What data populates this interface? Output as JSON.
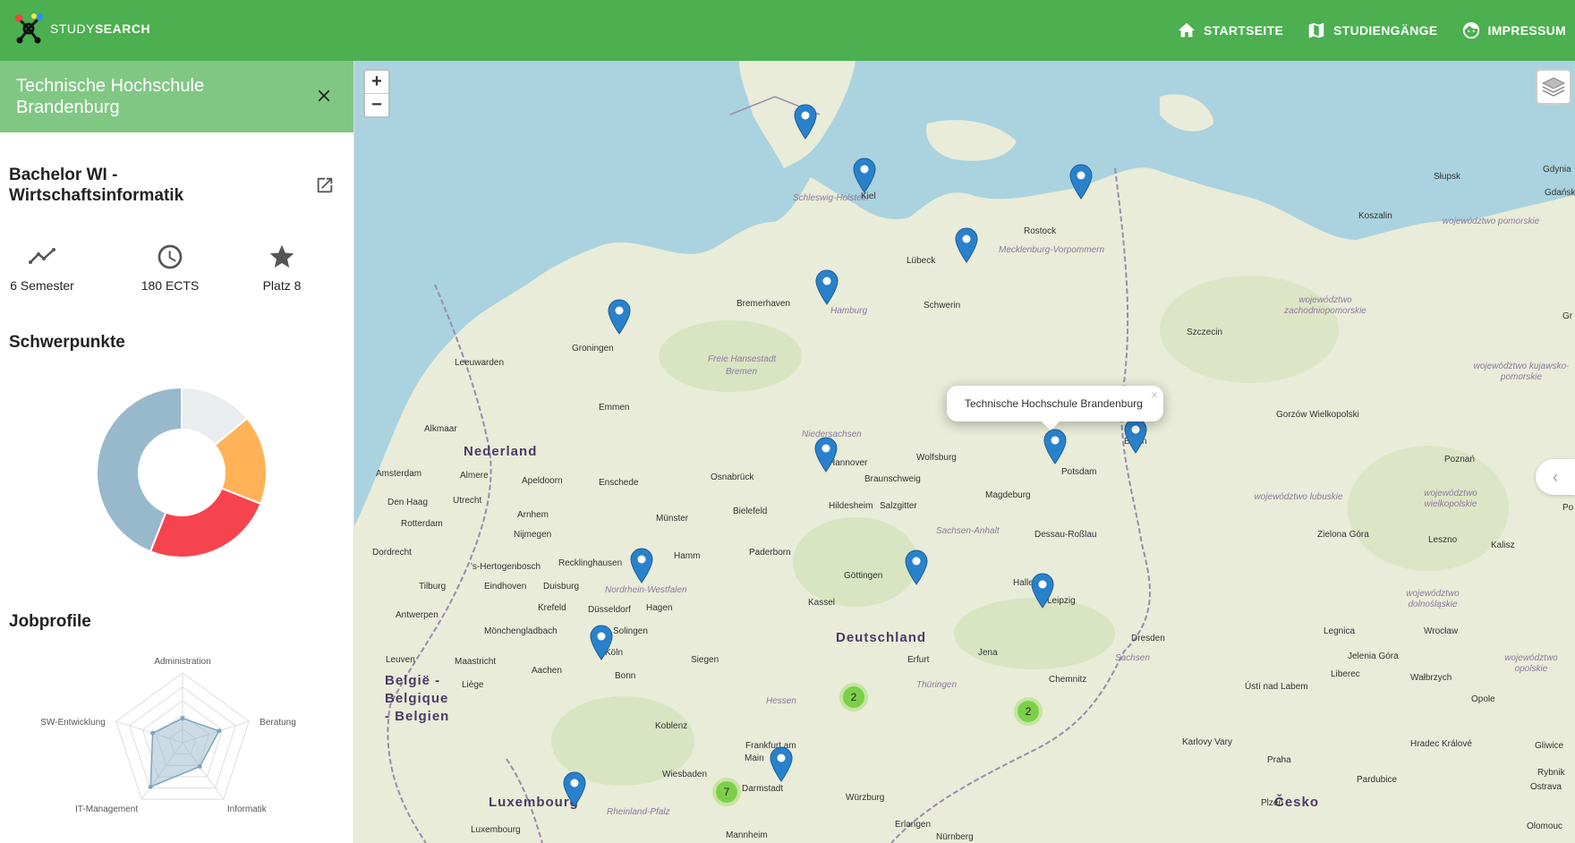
{
  "header": {
    "logo_text_light": "STUDY",
    "logo_text_bold": "SEARCH",
    "nav": [
      {
        "label": "STARTSEITE",
        "icon": "home-icon"
      },
      {
        "label": "STUDIENGÄNGE",
        "icon": "map-icon"
      },
      {
        "label": "IMPRESSUM",
        "icon": "face-icon"
      }
    ]
  },
  "sidebar": {
    "title": "Technische Hochschule Brandenburg",
    "program_title": "Bachelor WI - Wirtschaftsinformatik",
    "stats": [
      {
        "label": "6 Semester",
        "icon": "trending-icon"
      },
      {
        "label": "180 ECTS",
        "icon": "clock-icon"
      },
      {
        "label": "Platz 8",
        "icon": "star-icon"
      }
    ],
    "focus_title": "Schwerpunkte",
    "focus_chart": {
      "type": "pie",
      "values": [
        14,
        17,
        25,
        44
      ],
      "colors": [
        "#e9edf0",
        "#ffb257",
        "#f6444e",
        "#98b8cc"
      ]
    },
    "jobs_title": "Jobprofile",
    "jobs_chart": {
      "type": "radar",
      "labels": [
        "Administration",
        "Beratung",
        "Informatik",
        "IT-Management",
        "SW-Entwicklung"
      ],
      "values": [
        0.35,
        0.55,
        0.42,
        0.78,
        0.45
      ]
    }
  },
  "map": {
    "zoom_in": "+",
    "zoom_out": "−",
    "popup_text": "Technische Hochschule Brandenburg",
    "popup_close": "×",
    "collapse": "‹",
    "clusters": [
      "2",
      "2",
      "7"
    ],
    "colors": {
      "water": "#aad3df",
      "land": "#e9ecd8",
      "forest": "#cfe0b4",
      "header": "#4caf50",
      "sidebar_header": "#81c784",
      "pin": "#2a81cb"
    },
    "countries": [
      "Nederland",
      "Deutschland",
      "België -",
      "Belgique",
      "- Belgien",
      "Luxembourg",
      "Česko"
    ],
    "regions": [
      "Schleswig-Holstein",
      "Mecklenburg-Vorpommern",
      "Freie Hansestadt",
      "Bremen",
      "Hamburg",
      "Niedersachsen",
      "Sachsen-Anhalt",
      "Nordrhein-Westfalen",
      "Hessen",
      "Thüringen",
      "Sachsen",
      "Rheinland-Pfalz"
    ],
    "pl_regions": [
      "województwo pomorskie",
      "województwo zachodniopomorskie",
      "województwo kujawsko-pomorskie",
      "województwo lubuskie",
      "województwo wielkopolskie",
      "województwo dolnośląskie",
      "województwo opolskie"
    ],
    "places": [
      "Bremerhaven",
      "Lübeck",
      "Rostock",
      "Schwerin",
      "Kiel",
      "Groningen",
      "Leeuwarden",
      "Emmen",
      "Alkmaar",
      "Amsterdam",
      "Almere",
      "Den Haag",
      "Rotterdam",
      "Utrecht",
      "Apeldoorn",
      "Enschede",
      "Arnhem",
      "Nijmegen",
      "Dordrecht",
      "'s-Hertogenbosch",
      "Tilburg",
      "Eindhoven",
      "Antwerpen",
      "Leuven",
      "Maastricht",
      "Liège",
      "Osnabrück",
      "Münster",
      "Bielefeld",
      "Hannover",
      "Hildesheim",
      "Braunschweig",
      "Wolfsburg",
      "Salzgitter",
      "Magdeburg",
      "Potsdam",
      "Berlin",
      "Dessau-Roßlau",
      "Halle",
      "Leipzig",
      "Dresden",
      "Chemnitz",
      "Jena",
      "Erfurt",
      "Göttingen",
      "Kassel",
      "Paderborn",
      "Hamm",
      "Recklinghausen",
      "Duisburg",
      "Krefeld",
      "Düsseldorf",
      "Hagen",
      "Solingen",
      "Mönchengladbach",
      "Köln",
      "Bonn",
      "Aachen",
      "Siegen",
      "Koblenz",
      "Wiesbaden",
      "Frankfurt am",
      "Main",
      "Darmstadt",
      "Würzburg",
      "Erlangen",
      "Mannheim",
      "Nürnberg",
      "Luxembourg",
      "Praha",
      "Plzeň",
      "Karlovy Vary",
      "Ústí nad Labem",
      "Liberec",
      "Hradec Králové",
      "Pardubice",
      "Olomouc",
      "Gliwice",
      "Rybnik",
      "Ostrava",
      "Opole",
      "Wałbrzych",
      "Jelenia Góra",
      "Legnica",
      "Wrocław",
      "Leszno",
      "Kalisz",
      "Zielona Góra",
      "Poznań",
      "Gorzów Wielkopolski",
      "Szczecin",
      "Koszalin",
      "Słupsk",
      "Gdynia",
      "Gdańsk",
      "Gr",
      "Po"
    ]
  }
}
